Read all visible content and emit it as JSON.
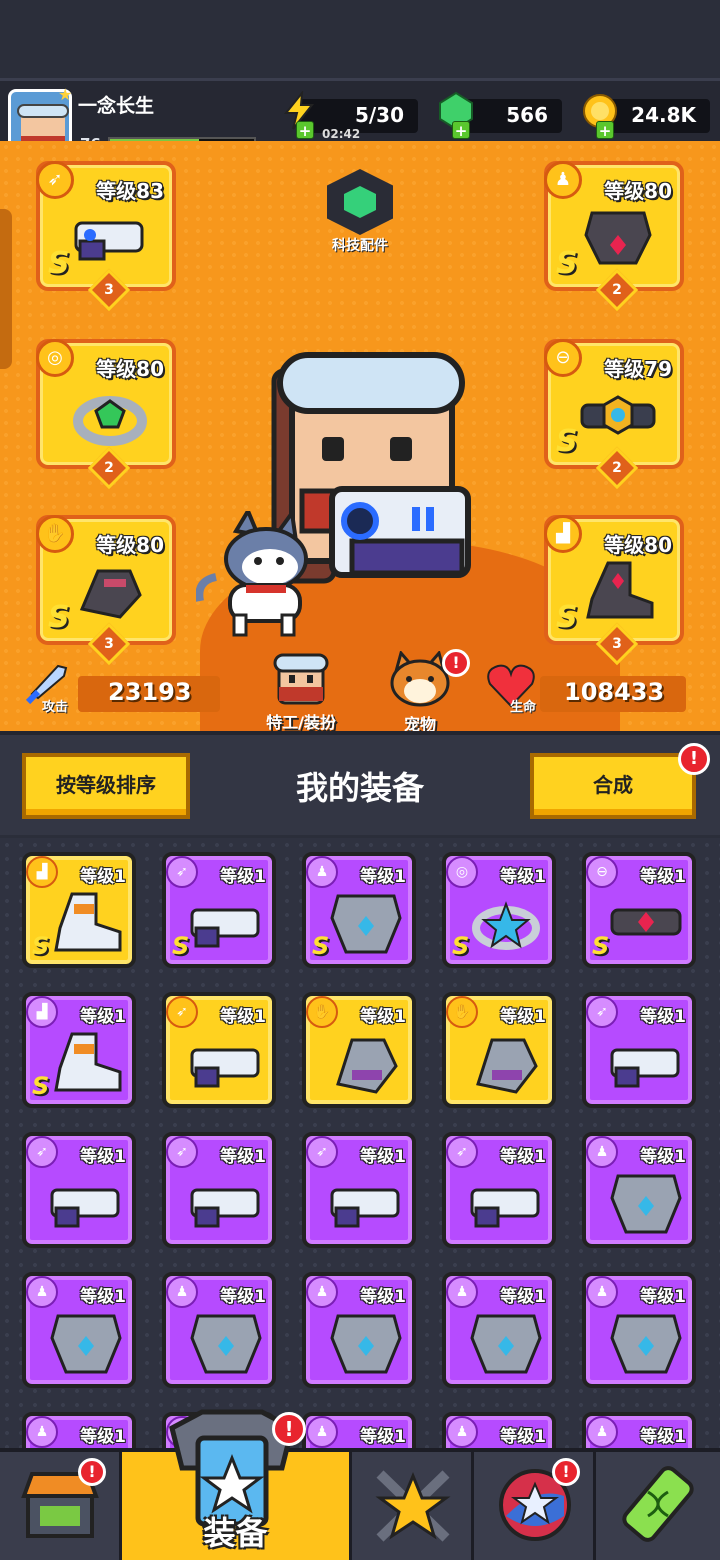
{
  "player": {
    "name": "一念长生",
    "level": "76",
    "xp_fraction": 0.62
  },
  "resources": {
    "energy": "5/30",
    "energy_timer": "02:42",
    "gems": "566",
    "coins": "24.8K"
  },
  "hero": {
    "tech_label": "科技配件",
    "attack_label": "攻击",
    "attack_value": "23193",
    "life_label": "生命",
    "life_value": "108433",
    "agent_label": "特工/装扮",
    "pet_label": "宠物",
    "slots": [
      {
        "level": "等级83",
        "rank": "S",
        "stars": "3",
        "icon": "weapon-icon"
      },
      {
        "level": "等级80",
        "rank": "S",
        "stars": "2",
        "icon": "armor-icon"
      },
      {
        "level": "等级80",
        "rank": "",
        "stars": "2",
        "icon": "ring-icon"
      },
      {
        "level": "等级79",
        "rank": "S",
        "stars": "2",
        "icon": "belt-icon"
      },
      {
        "level": "等级80",
        "rank": "S",
        "stars": "3",
        "icon": "glove-icon"
      },
      {
        "level": "等级80",
        "rank": "S",
        "stars": "3",
        "icon": "boot-icon"
      }
    ]
  },
  "equipment": {
    "sort_button": "按等级排序",
    "title": "我的装备",
    "merge_button": "合成",
    "alert_mark": "!",
    "items": [
      {
        "level": "等级1",
        "rank": "S",
        "color": "gold",
        "icon": "boot-icon"
      },
      {
        "level": "等级1",
        "rank": "S",
        "color": "purple",
        "icon": "weapon-icon"
      },
      {
        "level": "等级1",
        "rank": "S",
        "color": "purple",
        "icon": "armor-icon"
      },
      {
        "level": "等级1",
        "rank": "S",
        "color": "purple",
        "icon": "ring-icon"
      },
      {
        "level": "等级1",
        "rank": "S",
        "color": "purple",
        "icon": "belt-icon"
      },
      {
        "level": "等级1",
        "rank": "S",
        "color": "purple",
        "icon": "boot-icon"
      },
      {
        "level": "等级1",
        "rank": "",
        "color": "gold",
        "icon": "weapon-icon"
      },
      {
        "level": "等级1",
        "rank": "",
        "color": "gold",
        "icon": "glove-icon"
      },
      {
        "level": "等级1",
        "rank": "",
        "color": "gold",
        "icon": "glove-icon"
      },
      {
        "level": "等级1",
        "rank": "",
        "color": "purple",
        "icon": "weapon-icon"
      },
      {
        "level": "等级1",
        "rank": "",
        "color": "purple",
        "icon": "weapon-icon"
      },
      {
        "level": "等级1",
        "rank": "",
        "color": "purple",
        "icon": "weapon-icon"
      },
      {
        "level": "等级1",
        "rank": "",
        "color": "purple",
        "icon": "weapon-icon"
      },
      {
        "level": "等级1",
        "rank": "",
        "color": "purple",
        "icon": "weapon-icon"
      },
      {
        "level": "等级1",
        "rank": "",
        "color": "purple",
        "icon": "armor-icon"
      },
      {
        "level": "等级1",
        "rank": "",
        "color": "purple",
        "icon": "armor-icon"
      },
      {
        "level": "等级1",
        "rank": "",
        "color": "purple",
        "icon": "armor-icon"
      },
      {
        "level": "等级1",
        "rank": "",
        "color": "purple",
        "icon": "armor-icon"
      },
      {
        "level": "等级1",
        "rank": "",
        "color": "purple",
        "icon": "armor-icon"
      },
      {
        "level": "等级1",
        "rank": "",
        "color": "purple",
        "icon": "armor-icon"
      },
      {
        "level": "等级1",
        "rank": "",
        "color": "purple",
        "icon": "armor-icon"
      },
      {
        "level": "等级1",
        "rank": "",
        "color": "purple",
        "icon": "armor-icon"
      },
      {
        "level": "等级1",
        "rank": "",
        "color": "purple",
        "icon": "armor-icon"
      },
      {
        "level": "等级1",
        "rank": "",
        "color": "purple",
        "icon": "armor-icon"
      },
      {
        "level": "等级1",
        "rank": "",
        "color": "purple",
        "icon": "armor-icon"
      }
    ]
  },
  "nav": {
    "equip_label": "装备",
    "alert_mark": "!"
  },
  "colors": {
    "purple": "#b64bff",
    "gold": "#ffd21f",
    "hero_bg": "#f7971c"
  }
}
